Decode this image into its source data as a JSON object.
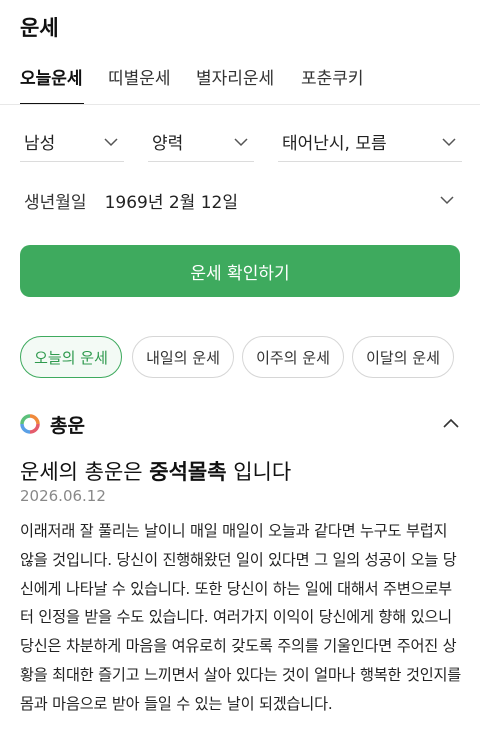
{
  "header": {
    "title": "운세"
  },
  "tabs": [
    {
      "label": "오늘운세",
      "active": true
    },
    {
      "label": "띠별운세",
      "active": false
    },
    {
      "label": "별자리운세",
      "active": false
    },
    {
      "label": "포춘쿠키",
      "active": false
    }
  ],
  "form": {
    "gender": "남성",
    "calendar": "양력",
    "birth_time": "태어난시, 모름",
    "birth_label": "생년월일",
    "birth_value": "1969년 2월 12일",
    "confirm_label": "운세 확인하기"
  },
  "period_tabs": [
    {
      "label": "오늘의 운세",
      "active": true
    },
    {
      "label": "내일의 운세",
      "active": false
    },
    {
      "label": "이주의 운세",
      "active": false
    },
    {
      "label": "이달의 운세",
      "active": false
    }
  ],
  "result": {
    "section_title": "총운",
    "headline_prefix": "운세의 총운은 ",
    "headline_keyword": "중석몰촉",
    "headline_suffix": " 입니다",
    "date": "2026.06.12",
    "body": "이래저래 잘 풀리는 날이니 매일 매일이 오늘과 같다면 누구도 부럽지 않을 것입니다. 당신이 진행해왔던 일이 있다면 그 일의 성공이 오늘 당신에게 나타날 수 있습니다. 또한 당신이 하는 일에 대해서 주변으로부터 인정을 받을 수도 있습니다. 여러가지 이익이 당신에게 향해 있으니 당신은 차분하게 마음을 여유로히 갖도록 주의를 기울인다면 주어진 상황을 최대한 즐기고 느끼면서 살아 있다는 것이 얼마나 행복한 것인지를 몸과 마음으로 받아 들일 수 있는 날이 되겠습니다."
  },
  "colors": {
    "accent": "#3eaa5e"
  }
}
